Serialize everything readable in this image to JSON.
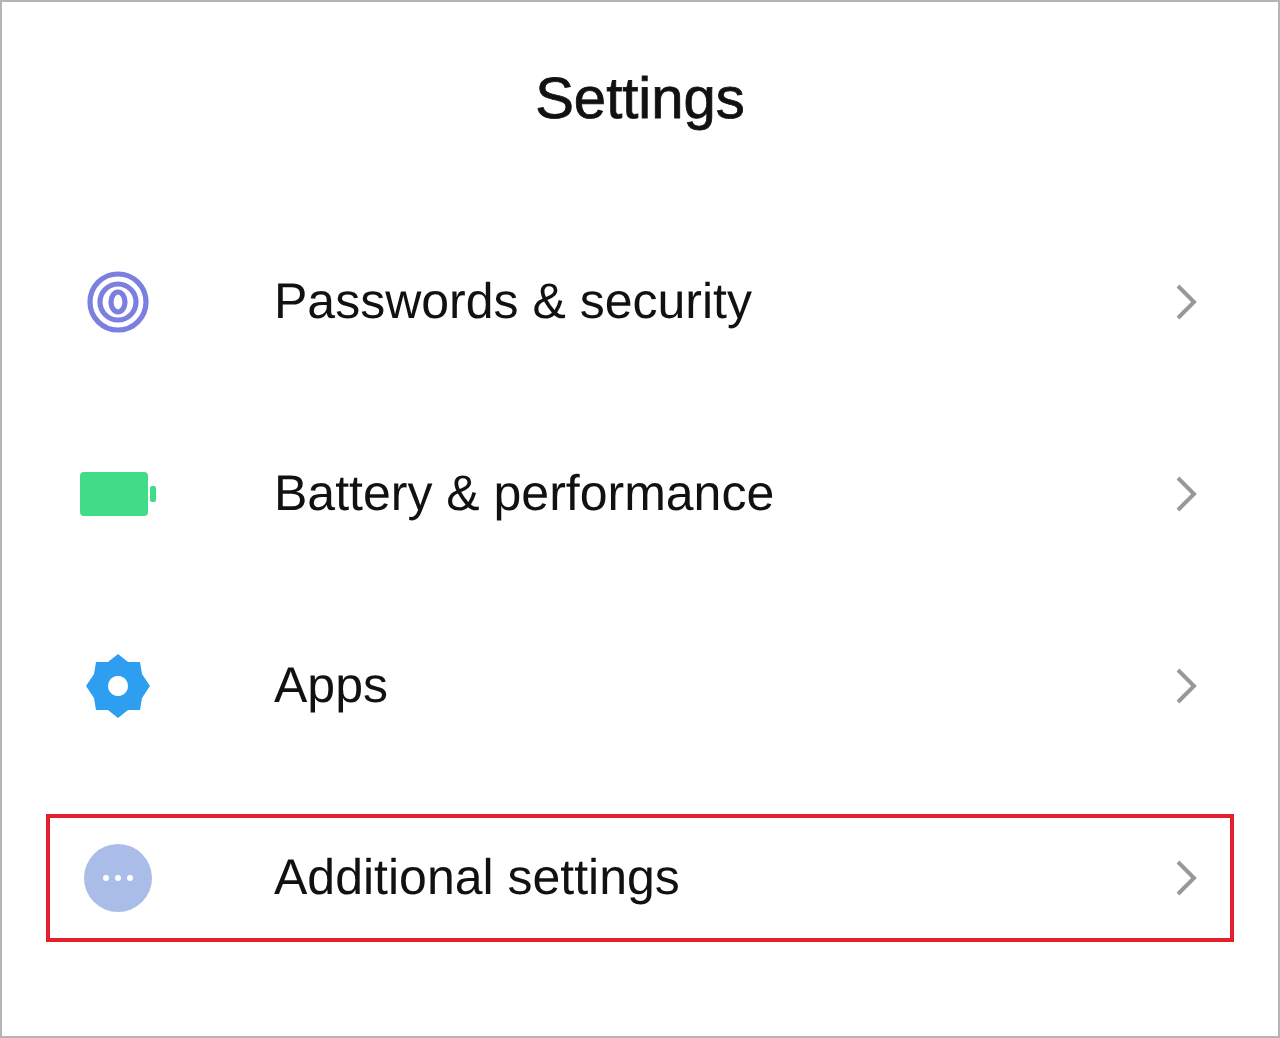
{
  "title": "Settings",
  "items": [
    {
      "kind": "fingerprint",
      "label": "Passwords & security",
      "highlighted": false
    },
    {
      "kind": "battery",
      "label": "Battery & performance",
      "highlighted": false
    },
    {
      "kind": "gear",
      "label": "Apps",
      "highlighted": false
    },
    {
      "kind": "more",
      "label": "Additional settings",
      "highlighted": true
    }
  ]
}
